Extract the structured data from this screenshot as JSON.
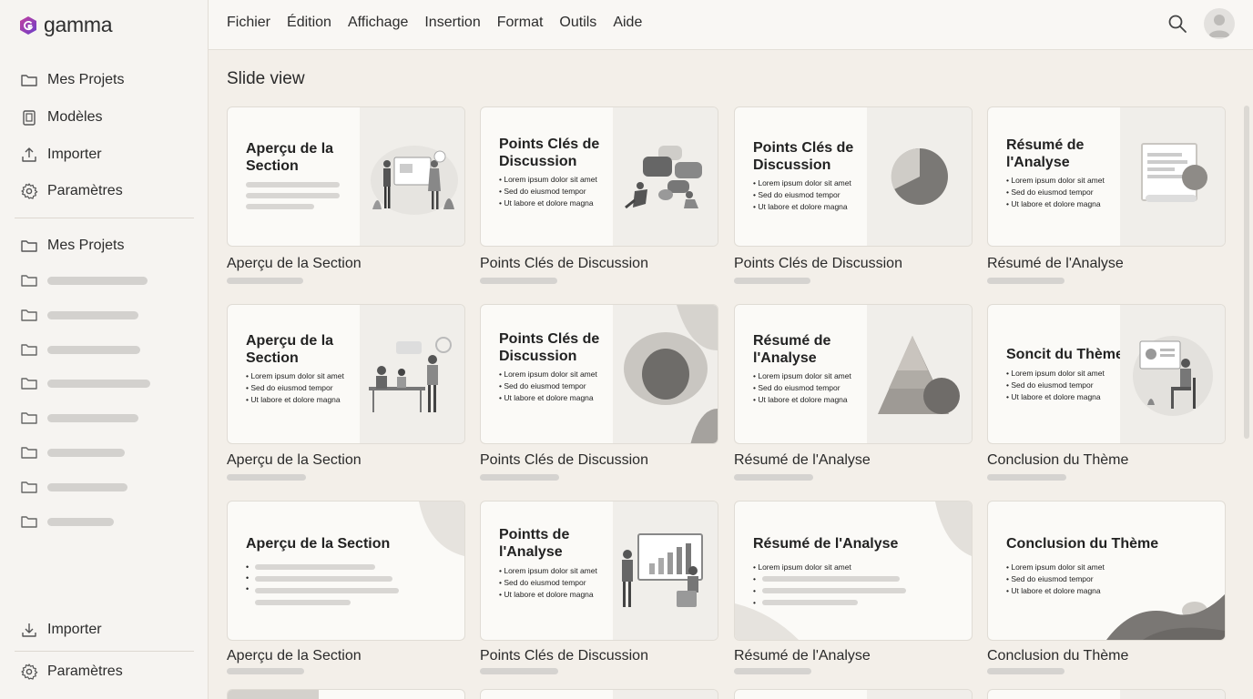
{
  "app": {
    "name": "gamma"
  },
  "sidebar": {
    "top_items": [
      {
        "label": "Mes Projets",
        "icon": "folder-icon"
      },
      {
        "label": "Modèles",
        "icon": "template-icon"
      },
      {
        "label": "Importer",
        "icon": "upload-icon"
      },
      {
        "label": "Paramètres",
        "icon": "gear-icon"
      }
    ],
    "folders_label": "Mes Projets",
    "bottom_items": [
      {
        "label": "Importer",
        "icon": "download-icon"
      },
      {
        "label": "Paramètres",
        "icon": "gear-icon"
      }
    ]
  },
  "menu": [
    "Fichier",
    "Édition",
    "Affichage",
    "Insertion",
    "Format",
    "Outils",
    "Aide"
  ],
  "page_title": "Slide view",
  "slides": [
    {
      "heading": "Aperçu de la Section",
      "bullets": [],
      "caption": "Aperçu de la Section"
    },
    {
      "heading": "Points Clés de Discussion",
      "bullets": [
        "Lorem ipsum dolor sit amet",
        "Sed do eiusmod tempor",
        "Ut labore et dolore magna"
      ],
      "caption": "Points Clés de Discussion"
    },
    {
      "heading": "Points Clés de Discussion",
      "bullets": [
        "Lorem ipsum dolor sit amet",
        "Sed do eiusmod tempor",
        "Ut labore et dolore magna"
      ],
      "caption": "Points Clés de Discussion"
    },
    {
      "heading": "Résumé de l'Analyse",
      "bullets": [
        "Lorem ipsum dolor sit amet",
        "Sed do eiusmod tempor",
        "Ut labore et dolore magna"
      ],
      "caption": "Résumé de l'Analyse"
    },
    {
      "heading": "Aperçu de la Section",
      "bullets": [
        "Lorem ipsum dolor sit amet",
        "Sed do eiusmod tempor",
        "Ut labore et dolore magna"
      ],
      "caption": "Aperçu de la Section"
    },
    {
      "heading": "Points Clés de Discussion",
      "bullets": [
        "Lorem ipsum dolor sit amet",
        "Sed do eiusmod tempor",
        "Ut labore et dolore magna"
      ],
      "caption": "Points Clés de Discussion"
    },
    {
      "heading": "Résumé de l'Analyse",
      "bullets": [
        "Lorem ipsum dolor sit amet",
        "Sed do eiusmod tempor",
        "Ut labore et dolore magna"
      ],
      "caption": "Résumé de l'Analyse"
    },
    {
      "heading": "Soncit du Thème",
      "bullets": [
        "Lorem ipsum dolor sit amet",
        "Sed do eiusmod tempor",
        "Ut labore et dolore magna"
      ],
      "caption": "Conclusion du Thème"
    },
    {
      "heading": "Aperçu de la Section",
      "bullets": [],
      "caption": "Aperçu de la Section"
    },
    {
      "heading": "Pointts de l'Analyse",
      "bullets": [
        "Lorem ipsum dolor sit amet",
        "Sed do eiusmod tempor",
        "Ut labore et dolore magna"
      ],
      "caption": "Points Clés de Discussion"
    },
    {
      "heading": "Résumé de l'Analyse",
      "bullets": [
        "Lorem ipsum dolor sit amet"
      ],
      "caption": "Résumé de l'Analyse"
    },
    {
      "heading": "Conclusion du Thème",
      "bullets": [
        "Lorem ipsum dolor sit amet",
        "Sed do eiusmod tempor",
        "Ut labore et dolore magna"
      ],
      "caption": "Conclusion du Thème"
    }
  ]
}
